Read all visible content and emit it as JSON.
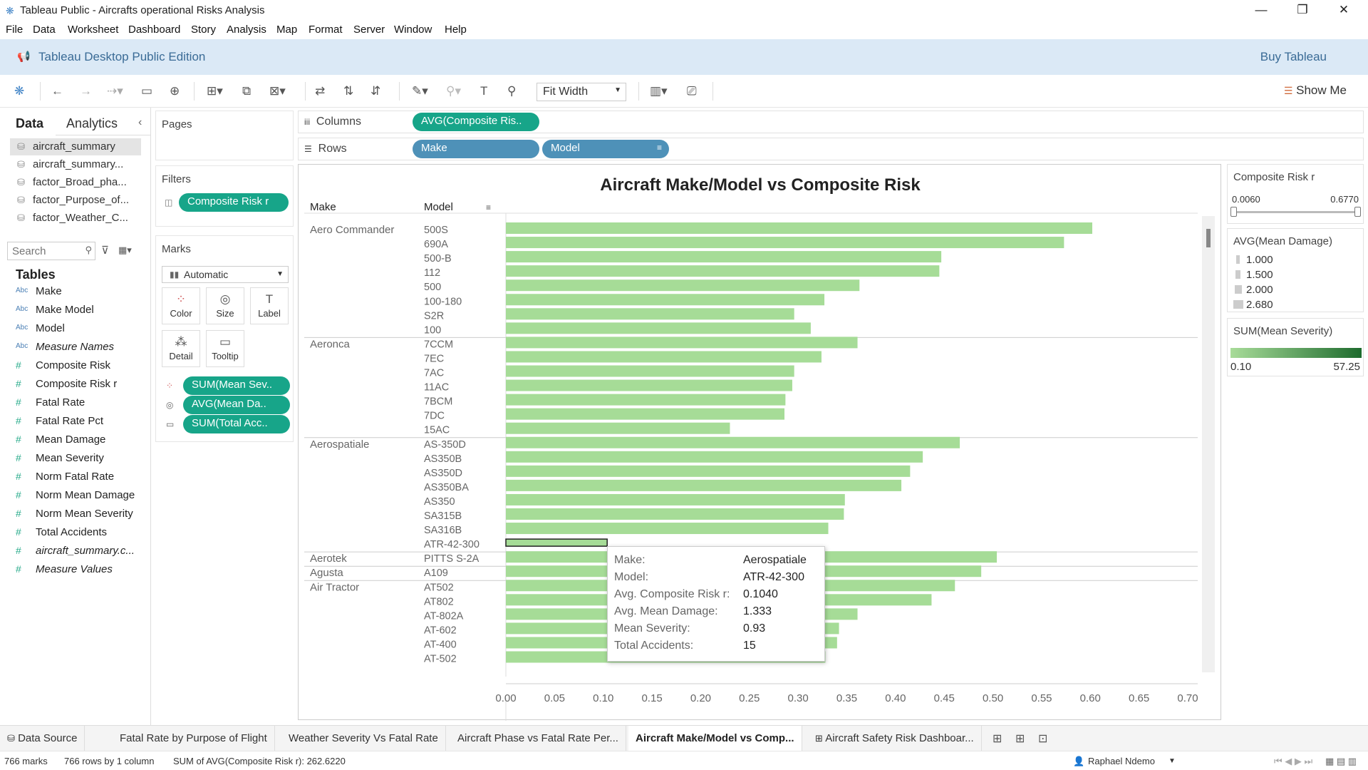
{
  "window": {
    "title": "Tableau Public - Aircrafts operational Risks Analysis",
    "minimize": "—",
    "restore": "❐",
    "close": "✕"
  },
  "menu": [
    "File",
    "Data",
    "Worksheet",
    "Dashboard",
    "Story",
    "Analysis",
    "Map",
    "Format",
    "Server",
    "Window",
    "Help"
  ],
  "banner": {
    "edition": "Tableau Desktop Public Edition",
    "buy": "Buy Tableau"
  },
  "toolbar": {
    "fit": "Fit Width",
    "show_me": "Show Me"
  },
  "data_pane": {
    "tab_data": "Data",
    "tab_analytics": "Analytics",
    "sources": [
      "aircraft_summary",
      "aircraft_summary...",
      "factor_Broad_pha...",
      "factor_Purpose_of...",
      "factor_Weather_C..."
    ],
    "search_placeholder": "Search",
    "tables_header": "Tables",
    "fields": [
      {
        "type": "Abc",
        "name": "Make",
        "italic": false
      },
      {
        "type": "Abc",
        "name": "Make Model",
        "italic": false
      },
      {
        "type": "Abc",
        "name": "Model",
        "italic": false
      },
      {
        "type": "Abc",
        "name": "Measure Names",
        "italic": true
      },
      {
        "type": "#",
        "name": "Composite Risk",
        "italic": false
      },
      {
        "type": "#",
        "name": "Composite Risk r",
        "italic": false
      },
      {
        "type": "#",
        "name": "Fatal Rate",
        "italic": false
      },
      {
        "type": "#",
        "name": "Fatal Rate Pct",
        "italic": false
      },
      {
        "type": "#",
        "name": "Mean Damage",
        "italic": false
      },
      {
        "type": "#",
        "name": "Mean Severity",
        "italic": false
      },
      {
        "type": "#",
        "name": "Norm Fatal Rate",
        "italic": false
      },
      {
        "type": "#",
        "name": "Norm Mean Damage",
        "italic": false
      },
      {
        "type": "#",
        "name": "Norm Mean Severity",
        "italic": false
      },
      {
        "type": "#",
        "name": "Total Accidents",
        "italic": false
      },
      {
        "type": "#",
        "name": "aircraft_summary.c...",
        "italic": true
      },
      {
        "type": "#",
        "name": "Measure Values",
        "italic": true
      }
    ]
  },
  "cards": {
    "pages": "Pages",
    "filters": "Filters",
    "filter_pill": "Composite Risk r",
    "marks": "Marks",
    "mark_type": "Automatic",
    "mark_buttons": [
      "Color",
      "Size",
      "Label",
      "Detail",
      "Tooltip"
    ],
    "mark_pills": [
      "SUM(Mean Sev..",
      "AVG(Mean Da..",
      "SUM(Total Acc.."
    ]
  },
  "shelves": {
    "columns_label": "Columns",
    "columns_pill": "AVG(Composite Ris..",
    "rows_label": "Rows",
    "rows_pills": [
      "Make",
      "Model"
    ]
  },
  "chart_data": {
    "type": "bar",
    "title": "Aircraft Make/Model vs Composite Risk",
    "xlabel": "Avg. Composite Risk r",
    "row_headers": [
      "Make",
      "Model"
    ],
    "xlim": [
      0,
      0.7
    ],
    "xticks": [
      "0.00",
      "0.05",
      "0.10",
      "0.15",
      "0.20",
      "0.25",
      "0.30",
      "0.35",
      "0.40",
      "0.45",
      "0.50",
      "0.55",
      "0.60",
      "0.65",
      "0.70"
    ],
    "groups": [
      {
        "make": "Aero Commander",
        "rows": [
          {
            "model": "500S",
            "value": 0.602
          },
          {
            "model": "690A",
            "value": 0.573
          },
          {
            "model": "500-B",
            "value": 0.447
          },
          {
            "model": "112",
            "value": 0.445
          },
          {
            "model": "500",
            "value": 0.363
          },
          {
            "model": "100-180",
            "value": 0.327
          },
          {
            "model": "S2R",
            "value": 0.296
          },
          {
            "model": "100",
            "value": 0.313
          }
        ]
      },
      {
        "make": "Aeronca",
        "rows": [
          {
            "model": "7CCM",
            "value": 0.361
          },
          {
            "model": "7EC",
            "value": 0.324
          },
          {
            "model": "7AC",
            "value": 0.296
          },
          {
            "model": "11AC",
            "value": 0.294
          },
          {
            "model": "7BCM",
            "value": 0.287
          },
          {
            "model": "7DC",
            "value": 0.286
          },
          {
            "model": "15AC",
            "value": 0.23
          }
        ]
      },
      {
        "make": "Aerospatiale",
        "rows": [
          {
            "model": "AS-350D",
            "value": 0.466
          },
          {
            "model": "AS350B",
            "value": 0.428
          },
          {
            "model": "AS350D",
            "value": 0.415
          },
          {
            "model": "AS350BA",
            "value": 0.406
          },
          {
            "model": "AS350",
            "value": 0.348
          },
          {
            "model": "SA315B",
            "value": 0.347
          },
          {
            "model": "SA316B",
            "value": 0.331
          },
          {
            "model": "ATR-42-300",
            "value": 0.104,
            "selected": true
          }
        ]
      },
      {
        "make": "Aerotek",
        "rows": [
          {
            "model": "PITTS S-2A",
            "value": 0.504
          }
        ]
      },
      {
        "make": "Agusta",
        "rows": [
          {
            "model": "A109",
            "value": 0.488
          }
        ]
      },
      {
        "make": "Air Tractor",
        "rows": [
          {
            "model": "AT502",
            "value": 0.461
          },
          {
            "model": "AT802",
            "value": 0.437
          },
          {
            "model": "AT-802A",
            "value": 0.361
          },
          {
            "model": "AT-602",
            "value": 0.342
          },
          {
            "model": "AT-400",
            "value": 0.34
          },
          {
            "model": "AT-502",
            "value": 0.328
          },
          {
            "model": "AT-402",
            "value": 0.29
          }
        ]
      }
    ]
  },
  "tooltip": [
    {
      "key": "Make:",
      "value": "Aerospatiale"
    },
    {
      "key": "Model:",
      "value": "ATR-42-300"
    },
    {
      "key": "Avg. Composite Risk r:",
      "value": "0.1040"
    },
    {
      "key": "Avg. Mean Damage:",
      "value": "1.333"
    },
    {
      "key": "Mean Severity:",
      "value": "0.93"
    },
    {
      "key": "Total Accidents:",
      "value": "15"
    }
  ],
  "legends": {
    "filter_title": "Composite Risk r",
    "filter_min": "0.0060",
    "filter_max": "0.6770",
    "size_title": "AVG(Mean Damage)",
    "size_items": [
      "1.000",
      "1.500",
      "2.000",
      "2.680"
    ],
    "color_title": "SUM(Mean Severity)",
    "color_min": "0.10",
    "color_max": "57.25",
    "color_start": "#a8dc99",
    "color_end": "#1e6b2e"
  },
  "sheet_tabs": [
    {
      "label": "Data Source",
      "active": false
    },
    {
      "label": "Fatal Rate by Purpose of Flight",
      "active": false
    },
    {
      "label": "Weather Severity Vs Fatal Rate",
      "active": false
    },
    {
      "label": "Aircraft Phase vs Fatal Rate Per...",
      "active": false
    },
    {
      "label": "Aircraft Make/Model vs Comp...",
      "active": true
    },
    {
      "label": "Aircraft Safety Risk Dashboar...",
      "active": false
    }
  ],
  "status": {
    "marks": "766 marks",
    "rows": "766 rows by 1 column",
    "sum": "SUM of AVG(Composite Risk r): 262.6220",
    "user": "Raphael Ndemo"
  }
}
